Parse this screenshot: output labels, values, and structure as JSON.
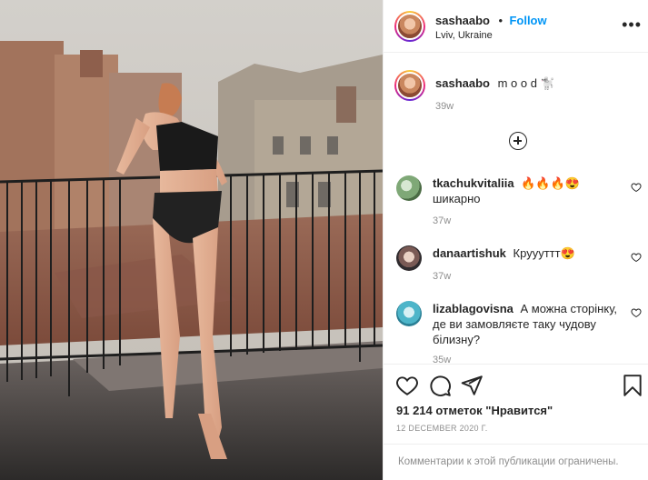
{
  "post": {
    "username": "sashaabo",
    "follow_label": "Follow",
    "separator": "•",
    "location": "Lviv, Ukraine",
    "more_icon": "more-horizontal-icon",
    "caption": "m o o d 🐩",
    "caption_age": "39w"
  },
  "comments": [
    {
      "username": "tkachukvitaliia",
      "text": "🔥🔥🔥😍 шикарно",
      "age": "37w"
    },
    {
      "username": "danaartishuk",
      "text": "Круууттт😍",
      "age": "37w"
    },
    {
      "username": "lizablagovisna",
      "text": "А можна сторінку, де ви замовляєте таку чудову білизну?",
      "age": "35w"
    }
  ],
  "actions": {
    "likes": "91 214 отметок \"Нравится\"",
    "date": "12 DECEMBER 2020 Г.",
    "restricted": "Комментарии к этой публикации ограничены.",
    "icons": [
      "heart-icon",
      "comment-icon",
      "share-icon",
      "bookmark-icon"
    ]
  },
  "colors": {
    "accent": "#0095f6",
    "text": "#262626",
    "muted": "#8e8e8e",
    "border": "#efefef"
  }
}
